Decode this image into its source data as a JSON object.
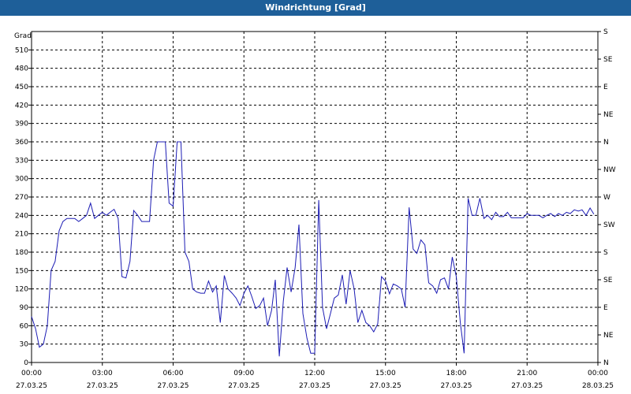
{
  "window": {
    "title": "Windrichtung [Grad]"
  },
  "chart_data": {
    "type": "line",
    "title": "Windrichtung [Grad]",
    "ylabel": "Grad",
    "ylim": [
      0,
      540
    ],
    "y_ticks": [
      0,
      30,
      60,
      90,
      120,
      150,
      180,
      210,
      240,
      270,
      300,
      330,
      360,
      390,
      420,
      450,
      480,
      510
    ],
    "right_axis_labels": [
      "N",
      "NE",
      "E",
      "SE",
      "S",
      "SW",
      "W",
      "NW",
      "N",
      "NE",
      "E",
      "SE",
      "S"
    ],
    "x_ticks": [
      {
        "time": "00:00",
        "date": "27.03.25"
      },
      {
        "time": "03:00",
        "date": "27.03.25"
      },
      {
        "time": "06:00",
        "date": "27.03.25"
      },
      {
        "time": "09:00",
        "date": "27.03.25"
      },
      {
        "time": "12:00",
        "date": "27.03.25"
      },
      {
        "time": "15:00",
        "date": "27.03.25"
      },
      {
        "time": "18:00",
        "date": "27.03.25"
      },
      {
        "time": "21:00",
        "date": "27.03.25"
      },
      {
        "time": "00:00",
        "date": "28.03.25"
      }
    ],
    "xlim_hours": [
      0,
      24
    ],
    "grid": true,
    "line_color": "#1c1cb4",
    "series": [
      {
        "points": [
          [
            0.0,
            75
          ],
          [
            0.17,
            55
          ],
          [
            0.33,
            25
          ],
          [
            0.5,
            30
          ],
          [
            0.67,
            60
          ],
          [
            0.83,
            150
          ],
          [
            1.0,
            165
          ],
          [
            1.17,
            215
          ],
          [
            1.33,
            230
          ],
          [
            1.5,
            235
          ],
          [
            1.67,
            235
          ],
          [
            1.83,
            235
          ],
          [
            2.0,
            230
          ],
          [
            2.17,
            235
          ],
          [
            2.33,
            240
          ],
          [
            2.5,
            260
          ],
          [
            2.67,
            235
          ],
          [
            2.83,
            240
          ],
          [
            3.0,
            245
          ],
          [
            3.17,
            240
          ],
          [
            3.33,
            245
          ],
          [
            3.5,
            250
          ],
          [
            3.67,
            235
          ],
          [
            3.83,
            140
          ],
          [
            4.0,
            138
          ],
          [
            4.17,
            165
          ],
          [
            4.33,
            248
          ],
          [
            4.5,
            240
          ],
          [
            4.67,
            230
          ],
          [
            4.83,
            230
          ],
          [
            5.0,
            230
          ],
          [
            5.17,
            330
          ],
          [
            5.33,
            360
          ],
          [
            5.5,
            360
          ],
          [
            5.67,
            360
          ],
          [
            5.83,
            260
          ],
          [
            6.0,
            255
          ],
          [
            6.17,
            360
          ],
          [
            6.33,
            360
          ],
          [
            6.5,
            180
          ],
          [
            6.67,
            165
          ],
          [
            6.83,
            120
          ],
          [
            7.0,
            115
          ],
          [
            7.17,
            113
          ],
          [
            7.33,
            113
          ],
          [
            7.5,
            133
          ],
          [
            7.67,
            115
          ],
          [
            7.83,
            125
          ],
          [
            8.0,
            65
          ],
          [
            8.17,
            142
          ],
          [
            8.33,
            120
          ],
          [
            8.5,
            113
          ],
          [
            8.67,
            105
          ],
          [
            8.83,
            93
          ],
          [
            9.0,
            113
          ],
          [
            9.17,
            125
          ],
          [
            9.33,
            108
          ],
          [
            9.5,
            88
          ],
          [
            9.67,
            93
          ],
          [
            9.83,
            105
          ],
          [
            10.0,
            60
          ],
          [
            10.17,
            85
          ],
          [
            10.33,
            135
          ],
          [
            10.5,
            10
          ],
          [
            10.67,
            100
          ],
          [
            10.83,
            155
          ],
          [
            11.0,
            115
          ],
          [
            11.17,
            155
          ],
          [
            11.33,
            225
          ],
          [
            11.5,
            80
          ],
          [
            11.67,
            40
          ],
          [
            11.83,
            15
          ],
          [
            12.0,
            15
          ],
          [
            12.17,
            265
          ],
          [
            12.33,
            90
          ],
          [
            12.5,
            55
          ],
          [
            12.67,
            80
          ],
          [
            12.83,
            105
          ],
          [
            13.0,
            110
          ],
          [
            13.17,
            143
          ],
          [
            13.33,
            95
          ],
          [
            13.5,
            150
          ],
          [
            13.67,
            120
          ],
          [
            13.83,
            65
          ],
          [
            14.0,
            85
          ],
          [
            14.17,
            65
          ],
          [
            14.33,
            60
          ],
          [
            14.5,
            50
          ],
          [
            14.67,
            63
          ],
          [
            14.83,
            140
          ],
          [
            15.0,
            133
          ],
          [
            15.17,
            112
          ],
          [
            15.33,
            128
          ],
          [
            15.5,
            125
          ],
          [
            15.67,
            120
          ],
          [
            15.83,
            90
          ],
          [
            16.0,
            253
          ],
          [
            16.17,
            185
          ],
          [
            16.33,
            178
          ],
          [
            16.5,
            200
          ],
          [
            16.67,
            192
          ],
          [
            16.83,
            130
          ],
          [
            17.0,
            125
          ],
          [
            17.17,
            113
          ],
          [
            17.33,
            135
          ],
          [
            17.5,
            138
          ],
          [
            17.67,
            120
          ],
          [
            17.83,
            172
          ],
          [
            18.0,
            140
          ],
          [
            18.17,
            65
          ],
          [
            18.33,
            15
          ],
          [
            18.5,
            268
          ],
          [
            18.67,
            240
          ],
          [
            18.83,
            240
          ],
          [
            19.0,
            268
          ],
          [
            19.17,
            235
          ],
          [
            19.33,
            240
          ],
          [
            19.5,
            233
          ],
          [
            19.67,
            245
          ],
          [
            19.83,
            238
          ],
          [
            20.0,
            238
          ],
          [
            20.17,
            245
          ],
          [
            20.33,
            236
          ],
          [
            20.5,
            236
          ],
          [
            20.67,
            236
          ],
          [
            20.83,
            236
          ],
          [
            21.0,
            243
          ],
          [
            21.17,
            240
          ],
          [
            21.33,
            240
          ],
          [
            21.5,
            240
          ],
          [
            21.67,
            236
          ],
          [
            21.83,
            240
          ],
          [
            22.0,
            243
          ],
          [
            22.17,
            238
          ],
          [
            22.33,
            243
          ],
          [
            22.5,
            240
          ],
          [
            22.67,
            245
          ],
          [
            22.83,
            243
          ],
          [
            23.0,
            249
          ],
          [
            23.17,
            247
          ],
          [
            23.33,
            249
          ],
          [
            23.5,
            240
          ],
          [
            23.67,
            252
          ],
          [
            23.83,
            242
          ]
        ]
      }
    ]
  }
}
